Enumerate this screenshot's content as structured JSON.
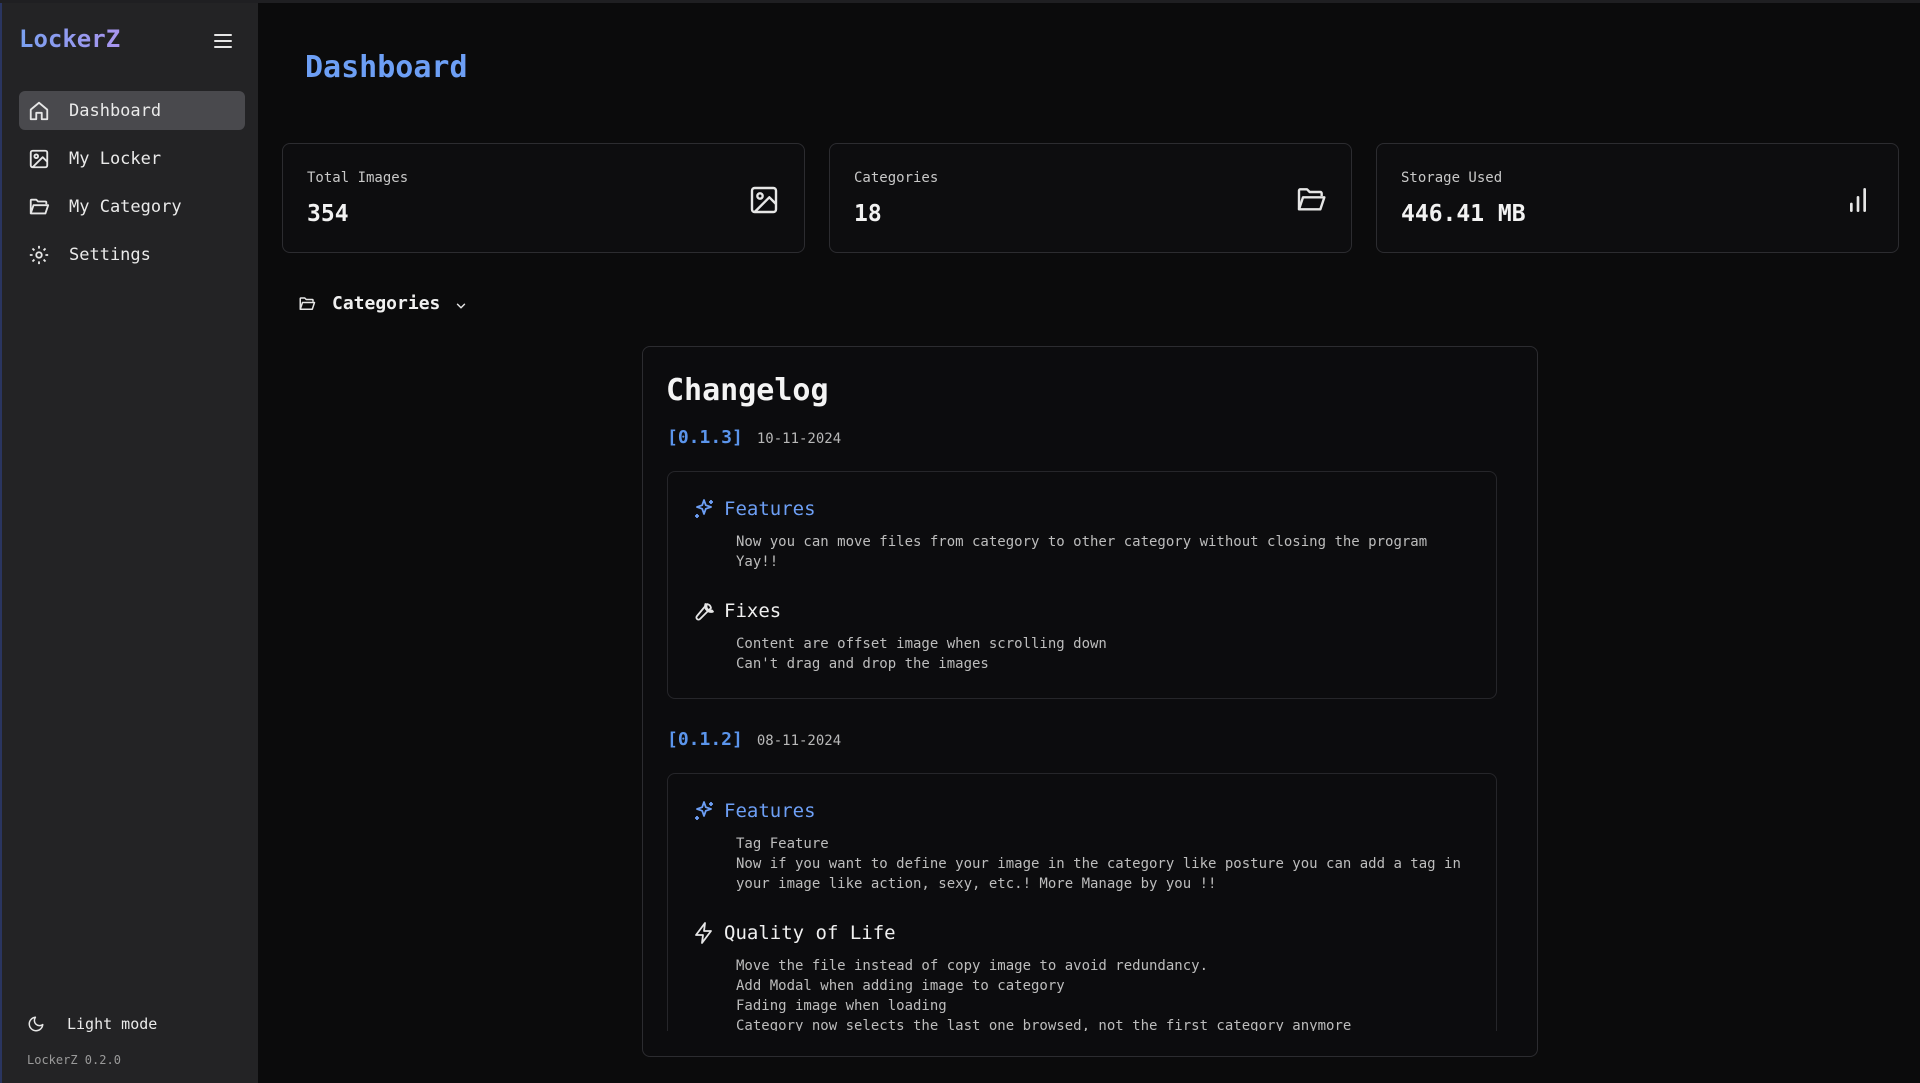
{
  "app": {
    "brand": "LockerZ",
    "version_label": "LockerZ 0.2.0"
  },
  "sidebar": {
    "items": [
      {
        "label": "Dashboard",
        "icon": "home-icon",
        "active": true
      },
      {
        "label": "My Locker",
        "icon": "image-icon",
        "active": false
      },
      {
        "label": "My Category",
        "icon": "folder-open-icon",
        "active": false
      },
      {
        "label": "Settings",
        "icon": "gear-icon",
        "active": false
      }
    ],
    "theme_toggle": {
      "label": "Light mode",
      "icon": "moon-icon"
    }
  },
  "main": {
    "title": "Dashboard",
    "stats": [
      {
        "label": "Total Images",
        "value": "354",
        "icon": "image-icon"
      },
      {
        "label": "Categories",
        "value": "18",
        "icon": "folder-open-icon"
      },
      {
        "label": "Storage Used",
        "value": "446.41 MB",
        "icon": "bar-chart-icon"
      }
    ],
    "categories_toggle": {
      "label": "Categories",
      "icon": "folder-open-icon",
      "chevron": "chevron-down-icon"
    }
  },
  "changelog": {
    "title": "Changelog",
    "versions": [
      {
        "version": "[0.1.3]",
        "date": "10-11-2024",
        "sections": [
          {
            "title": "Features",
            "icon": "sparkles-icon",
            "style": "blue",
            "lines": [
              "Now you can move files from category to other category without closing the program Yay!!"
            ]
          },
          {
            "title": "Fixes",
            "icon": "wrench-icon",
            "style": "white",
            "lines": [
              "Content are offset image when scrolling down",
              "Can't drag and drop the images"
            ]
          }
        ]
      },
      {
        "version": "[0.1.2]",
        "date": "08-11-2024",
        "sections": [
          {
            "title": "Features",
            "icon": "sparkles-icon",
            "style": "blue",
            "lines": [
              "Tag Feature",
              "Now if you want to define your image in the category like posture you can add a tag in",
              "your image like action, sexy, etc.! More Manage by you !!"
            ]
          },
          {
            "title": "Quality of Life",
            "icon": "zap-icon",
            "style": "white",
            "lines": [
              "Move the file instead of copy image to avoid redundancy.",
              "Add Modal when adding image to category",
              "Fading image when loading",
              "Category now selects the last one browsed, not the first category anymore"
            ]
          }
        ]
      }
    ]
  },
  "colors": {
    "accent": "#6d9ff5",
    "active_nav_bg": "#49494d",
    "sidebar_bg": "#232325",
    "page_bg": "#0b0b0c"
  }
}
